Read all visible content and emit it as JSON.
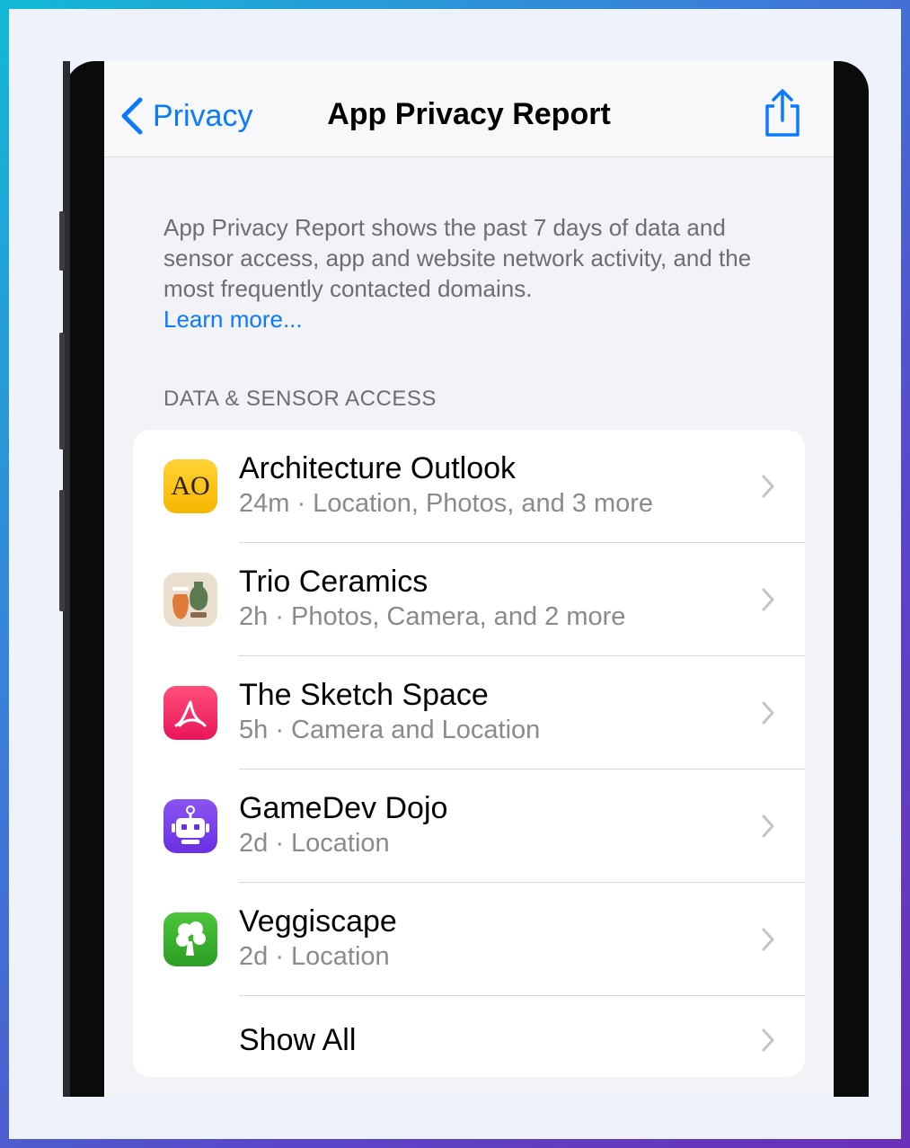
{
  "nav": {
    "back_label": "Privacy",
    "title": "App Privacy Report",
    "share_icon": "share-icon"
  },
  "intro": {
    "text": "App Privacy Report shows the past 7 days of data and sensor access, app and website network activity, and the most frequently contacted domains.",
    "link": "Learn more..."
  },
  "section": {
    "header": "DATA & SENSOR ACCESS"
  },
  "apps": [
    {
      "name": "Architecture Outlook",
      "detail": "24m · Location, Photos, and 3 more",
      "icon": "architecture-outlook-icon",
      "icon_text": "AO"
    },
    {
      "name": "Trio Ceramics",
      "detail": "2h · Photos, Camera, and 2 more",
      "icon": "trio-ceramics-icon"
    },
    {
      "name": "The Sketch Space",
      "detail": "5h · Camera and Location",
      "icon": "sketch-space-icon"
    },
    {
      "name": "GameDev Dojo",
      "detail": "2d · Location",
      "icon": "gamedev-dojo-icon"
    },
    {
      "name": "Veggiscape",
      "detail": "2d · Location",
      "icon": "veggiscape-icon"
    }
  ],
  "show_all_label": "Show All",
  "colors": {
    "accent": "#0a7aff",
    "background": "#f2f2f7",
    "secondary_text": "#8a8a8e"
  }
}
